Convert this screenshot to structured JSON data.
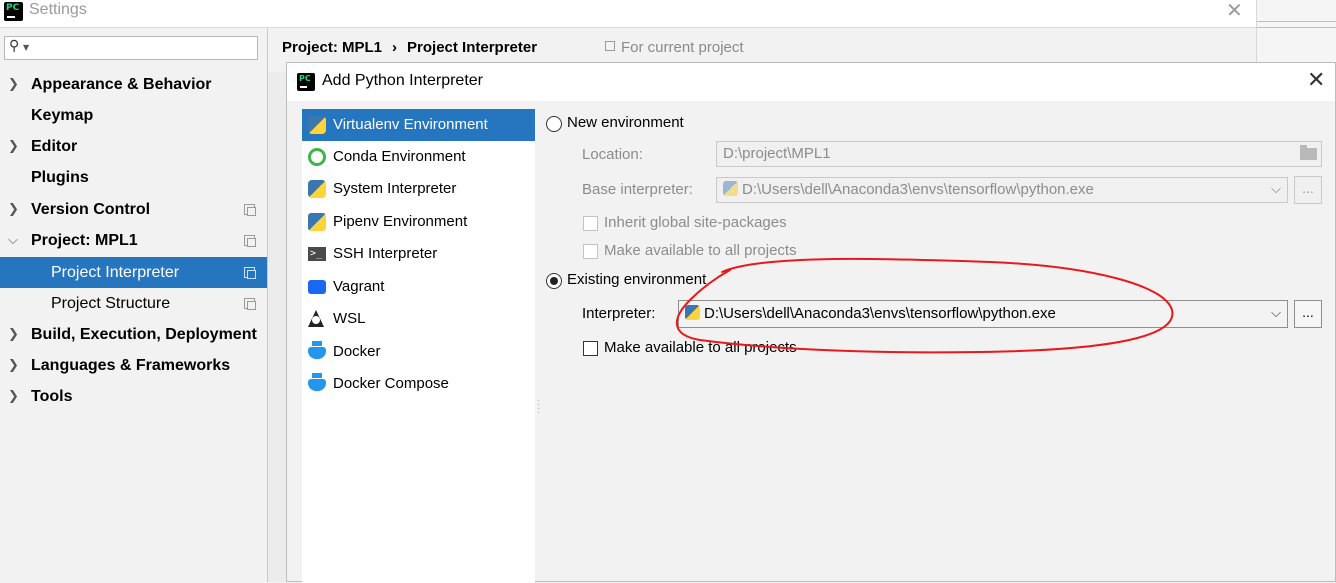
{
  "settings": {
    "title": "Settings",
    "app_icon_text": "PC",
    "search": {
      "value": "",
      "placeholder": ""
    }
  },
  "sidebar": {
    "items": [
      {
        "label": "Appearance & Behavior"
      },
      {
        "label": "Keymap"
      },
      {
        "label": "Editor"
      },
      {
        "label": "Plugins"
      },
      {
        "label": "Version Control"
      },
      {
        "label": "Project: MPL1"
      },
      {
        "label": "Project Interpreter"
      },
      {
        "label": "Project Structure"
      },
      {
        "label": "Build, Execution, Deployment"
      },
      {
        "label": "Languages & Frameworks"
      },
      {
        "label": "Tools"
      }
    ]
  },
  "breadcrumb": {
    "project": "Project: MPL1",
    "separator": "›",
    "page": "Project Interpreter",
    "note": "For current project"
  },
  "dialog": {
    "title": "Add Python Interpreter",
    "app_icon_text": "PC",
    "environments": [
      {
        "label": "Virtualenv Environment",
        "icon": "python-icon"
      },
      {
        "label": "Conda Environment",
        "icon": "conda-icon"
      },
      {
        "label": "System Interpreter",
        "icon": "python-icon"
      },
      {
        "label": "Pipenv Environment",
        "icon": "pipenv-icon"
      },
      {
        "label": "SSH Interpreter",
        "icon": "terminal-icon",
        "glyph": ">_"
      },
      {
        "label": "Vagrant",
        "icon": "vagrant-icon"
      },
      {
        "label": "WSL",
        "icon": "linux-penguin-icon"
      },
      {
        "label": "Docker",
        "icon": "docker-icon"
      },
      {
        "label": "Docker Compose",
        "icon": "docker-compose-icon"
      }
    ],
    "new_env": {
      "label": "New environment",
      "location_label": "Location:",
      "location_value": "D:\\project\\MPL1",
      "base_label": "Base interpreter:",
      "base_value": "D:\\Users\\dell\\Anaconda3\\envs\\tensorflow\\python.exe",
      "inherit_label": "Inherit global site-packages",
      "make_available_label": "Make available to all projects"
    },
    "existing_env": {
      "label": "Existing environment",
      "interpreter_label": "Interpreter:",
      "interpreter_value": "D:\\Users\\dell\\Anaconda3\\envs\\tensorflow\\python.exe",
      "make_available_label": "Make available to all projects"
    },
    "browse_label": "...",
    "dropdown_glyph": "⌵"
  },
  "colors": {
    "selection": "#2675bf",
    "annotation": "#e8191c"
  }
}
